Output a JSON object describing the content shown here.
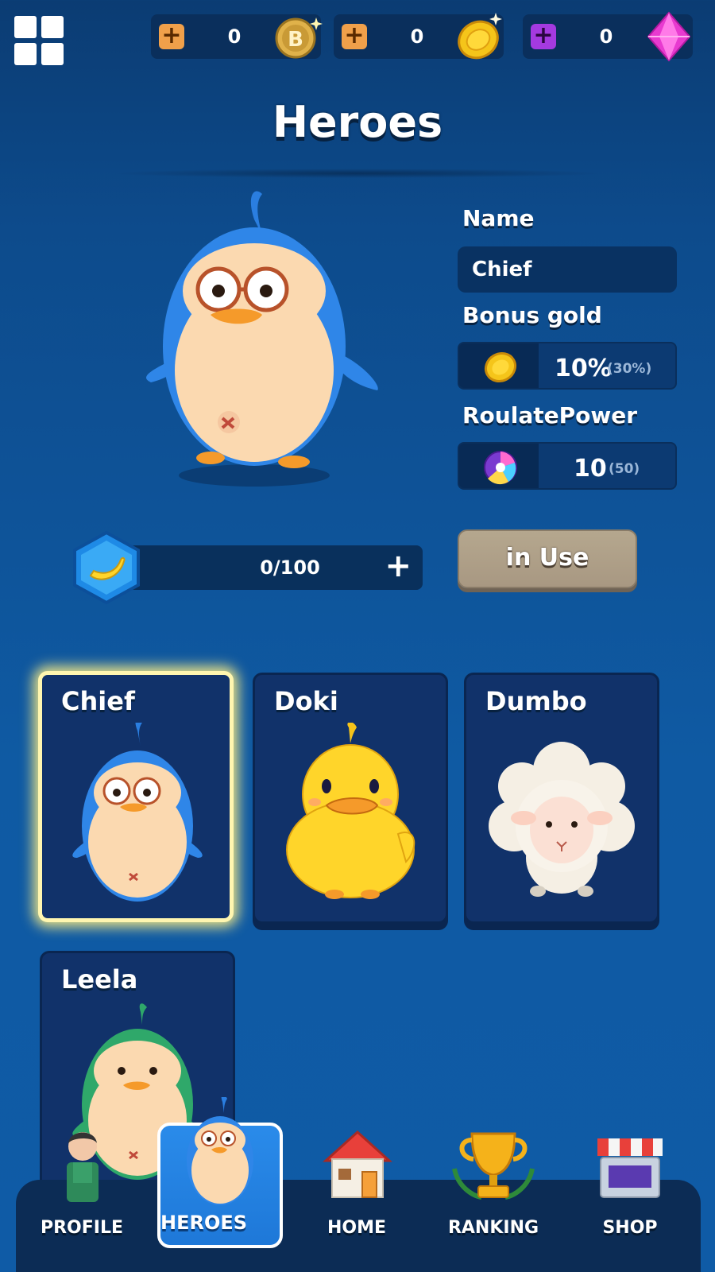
{
  "currency": [
    {
      "value": "0",
      "icon": "b-token-icon",
      "color": "#f0a04a"
    },
    {
      "value": "0",
      "icon": "gold-coin-icon",
      "color": "#f0a04a"
    },
    {
      "value": "0",
      "icon": "gem-icon",
      "color": "#a43ae0"
    }
  ],
  "page_title": "Heroes",
  "hero": {
    "name_label": "Name",
    "name_value": "Chief",
    "bonus_label": "Bonus gold",
    "bonus_value": "10%",
    "bonus_max": "(30%)",
    "power_label": "RoulatePower",
    "power_value": "10",
    "power_max": "(50)",
    "food_progress": "0/100",
    "food_add": "+",
    "status_button": "in Use"
  },
  "cards": [
    {
      "name": "Chief",
      "selected": true
    },
    {
      "name": "Doki",
      "selected": false
    },
    {
      "name": "Dumbo",
      "selected": false
    },
    {
      "name": "Leela",
      "selected": false
    }
  ],
  "nav": [
    {
      "label": "PROFILE",
      "icon": "profile-icon"
    },
    {
      "label": "HEROES",
      "icon": "heroes-icon",
      "active": true
    },
    {
      "label": "HOME",
      "icon": "home-icon"
    },
    {
      "label": "RANKING",
      "icon": "trophy-icon"
    },
    {
      "label": "SHOP",
      "icon": "shop-icon"
    }
  ]
}
